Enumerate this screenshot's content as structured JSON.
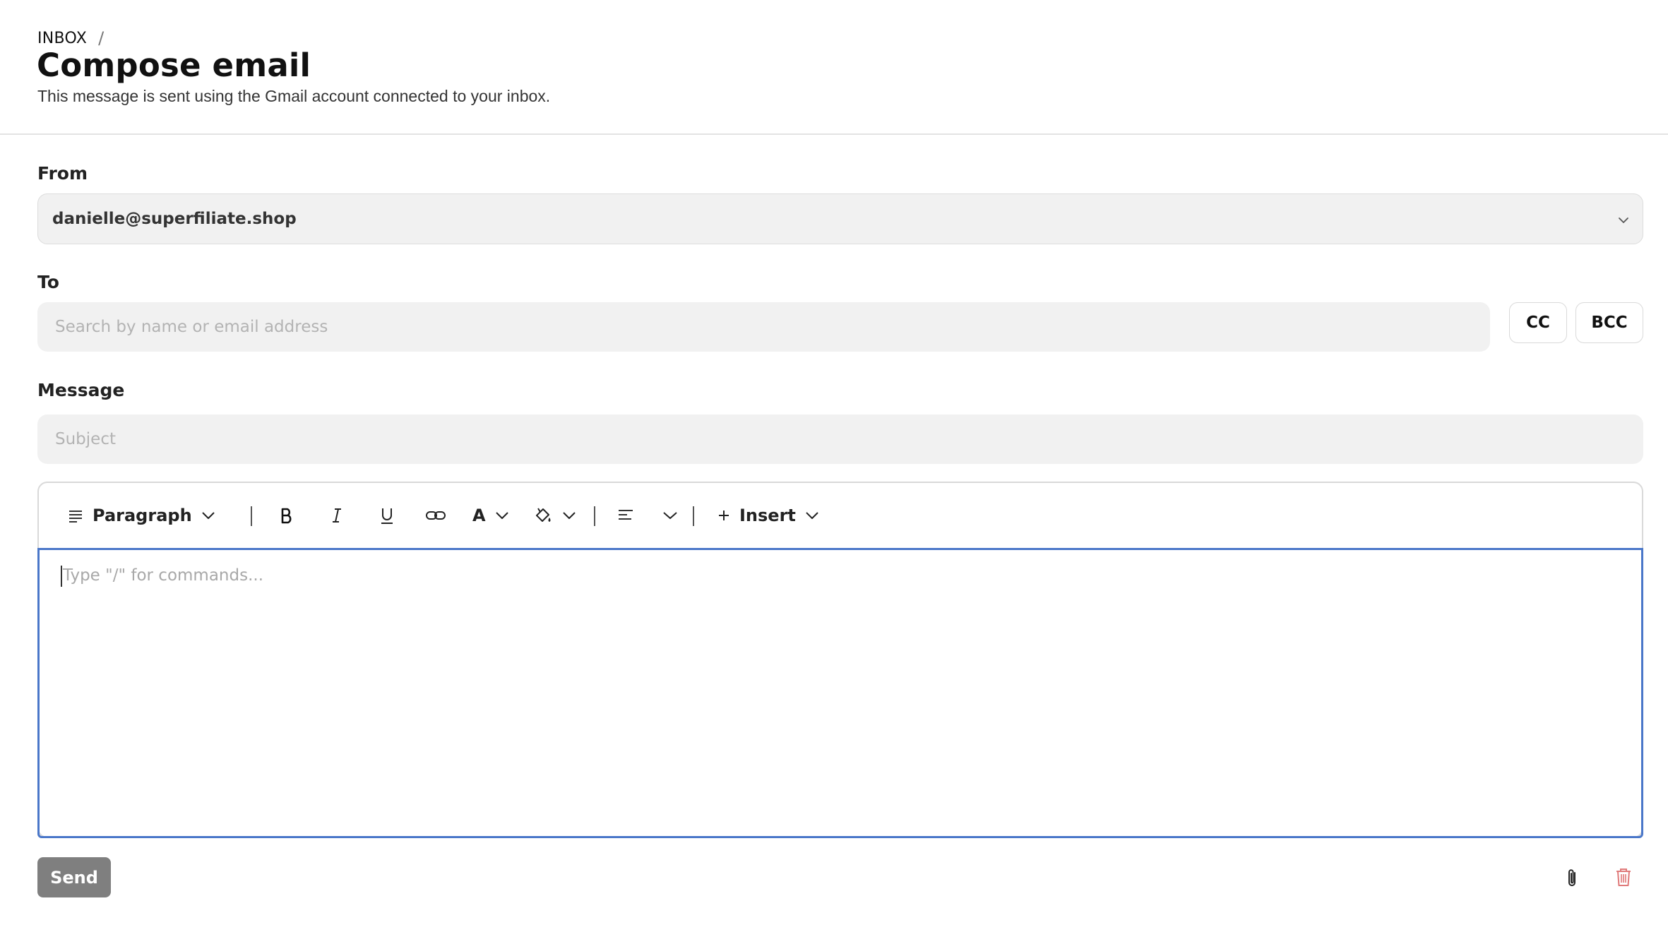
{
  "header": {
    "breadcrumb": {
      "root": "INBOX",
      "separator": "/"
    },
    "title": "Compose email",
    "subtitle": "This message is sent using the Gmail account connected to your inbox."
  },
  "from": {
    "label": "From",
    "selected_value": "danielle@superfiliate.shop",
    "icon": "chevron-down-icon"
  },
  "to": {
    "label": "To",
    "placeholder": "Search by name or email address",
    "value": "",
    "cc_label": "CC",
    "bcc_label": "BCC"
  },
  "message": {
    "label": "Message",
    "subject_placeholder": "Subject",
    "subject_value": "",
    "toolbar": {
      "block_style": "Paragraph",
      "insert_label": "Insert",
      "text_color_glyph": "A",
      "icons": [
        "paragraph-icon",
        "bold-icon",
        "italic-icon",
        "underline-icon",
        "link-icon",
        "text-color-icon",
        "highlight-icon",
        "align-left-icon",
        "plus-icon",
        "chevron-down-icon"
      ]
    },
    "body_placeholder": "Type \"/\" for commands..."
  },
  "footer": {
    "send_label": "Send",
    "icons": [
      "attachment-icon",
      "trash-icon"
    ]
  },
  "colors": {
    "field_background": "#f1f1f1",
    "editor_focus_border": "#4a77c9",
    "send_button": "#7f7f7f",
    "trash_icon": "#e07a7a"
  }
}
